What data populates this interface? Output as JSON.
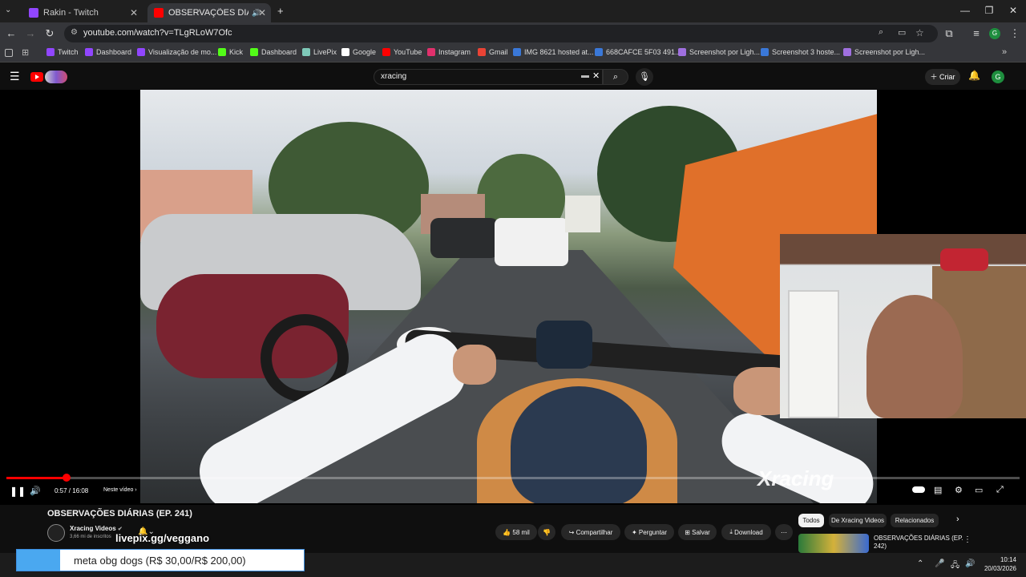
{
  "browser": {
    "tabs": [
      {
        "title": "Rakin - Twitch",
        "color": "#9146ff",
        "active": false
      },
      {
        "title": "OBSERVAÇÕES DIÁRIAS (EP...",
        "color": "#ff0000",
        "active": true
      }
    ],
    "url": "youtube.com/watch?v=TLgRLoW7Ofc",
    "bookmarks": [
      {
        "label": "Twitch",
        "color": "#9146ff"
      },
      {
        "label": "Dashboard",
        "color": "#9146ff"
      },
      {
        "label": "Visualização de mo...",
        "color": "#9146ff"
      },
      {
        "label": "Kick",
        "color": "#53fc18"
      },
      {
        "label": "Dashboard",
        "color": "#53fc18"
      },
      {
        "label": "LivePix",
        "color": "#7ec8b8"
      },
      {
        "label": "Google",
        "color": "#ffffff"
      },
      {
        "label": "YouTube",
        "color": "#ff0000"
      },
      {
        "label": "Instagram",
        "color": "#e1306c"
      },
      {
        "label": "Gmail",
        "color": "#ea4335"
      },
      {
        "label": "IMG 8621 hosted at...",
        "color": "#3a78d8"
      },
      {
        "label": "668CAFCE 5F03 491...",
        "color": "#3a78d8"
      },
      {
        "label": "Screenshot por Ligh...",
        "color": "#a070e0"
      },
      {
        "label": "Screenshot 3 hoste...",
        "color": "#3a78d8"
      },
      {
        "label": "Screenshot por Ligh...",
        "color": "#a070e0"
      }
    ]
  },
  "youtube": {
    "search_query": "xracing",
    "create_label": "Criar",
    "avatar_letter": "G",
    "player": {
      "time": "0:57 / 16:08",
      "next_label": "Neste vídeo",
      "progress_fraction": 0.059,
      "watermark": "Xracing"
    },
    "video_title": "OBSERVAÇÕES DIÁRIAS (EP. 241)",
    "channel_name": "Xracing Videos",
    "subscribers": "3,66 mi de inscritos",
    "likes": "58 mil",
    "actions": [
      "Compartilhar",
      "Perguntar",
      "Salvar",
      "Download"
    ],
    "chips": [
      "Todos",
      "De Xracing Videos",
      "Relacionados"
    ],
    "related": {
      "title_line1": "OBSERVAÇÕES DIÁRIAS (EP.",
      "title_line2": "242)"
    }
  },
  "overlay": {
    "livepix": "livepix.gg/veggano",
    "meta": "meta obg dogs (R$ 30,00/R$ 200,00)"
  },
  "taskbar": {
    "time": "10:14",
    "date": "20/03/2026"
  }
}
